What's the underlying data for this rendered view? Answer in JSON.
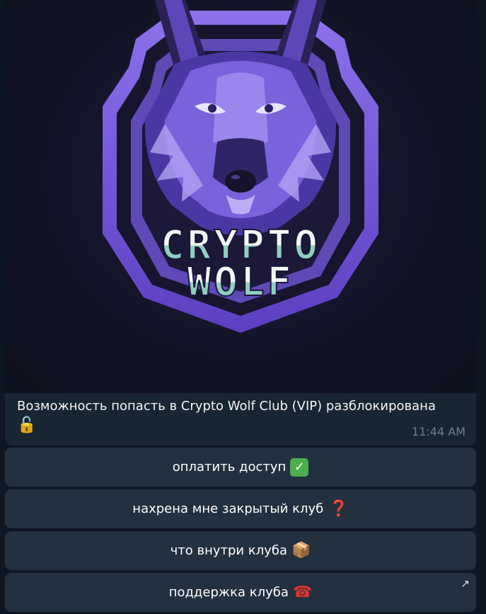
{
  "message": {
    "caption_text": "Возможность попасть в Crypto Wolf Club (VIP) разблокирована",
    "caption_emoji": "🔓",
    "time": "11:44 AM",
    "image": {
      "logo_line1": "CRYPTO",
      "logo_line2": "WOLF",
      "accent_colors": [
        "#6a4fd0",
        "#9d86f0",
        "#bfe6dc"
      ]
    }
  },
  "keyboard": {
    "buttons": [
      {
        "label": "оплатить доступ",
        "emoji": "✓"
      },
      {
        "label": "нахрена мне закрытый клуб",
        "emoji": "❓"
      },
      {
        "label": "что внутри клуба",
        "emoji": "📦"
      },
      {
        "label": "поддержка клуба",
        "emoji": "☎"
      }
    ],
    "link_icon": "↗"
  }
}
